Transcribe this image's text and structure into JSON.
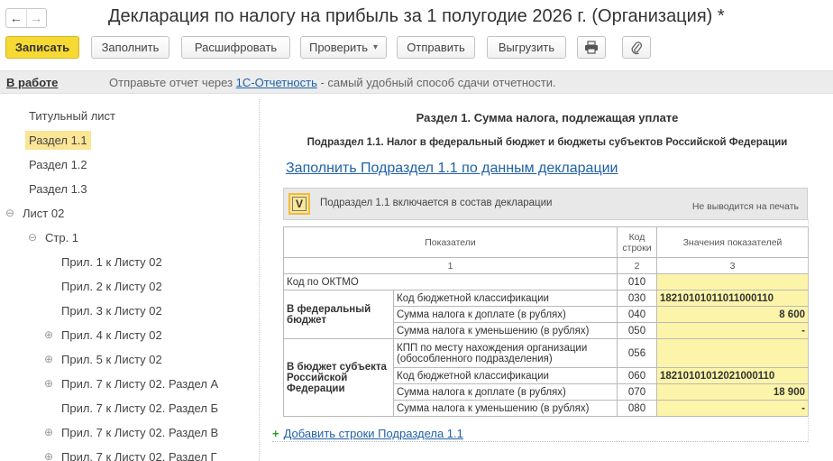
{
  "window": {
    "title": "Декларация по налогу на прибыль за 1 полугодие 2026 г. (Организация) *",
    "back_icon": "←",
    "forward_icon": "→"
  },
  "toolbar": {
    "save_label": "Записать",
    "fill_label": "Заполнить",
    "decode_label": "Расшифровать",
    "check_label": "Проверить",
    "check_dropdown": "▾",
    "send_label": "Отправить",
    "export_label": "Выгрузить",
    "print_icon": "printer-icon",
    "attach_icon": "paperclip-icon"
  },
  "infobar": {
    "status": "В работе",
    "message_before": "Отправьте отчет через ",
    "message_link": "1С-Отчетность",
    "message_after": " - самый удобный способ сдачи отчетности."
  },
  "tree": {
    "items": [
      {
        "label": "Титульный лист",
        "exp": ""
      },
      {
        "label": "Раздел 1.1",
        "exp": ""
      },
      {
        "label": "Раздел 1.2",
        "exp": ""
      },
      {
        "label": "Раздел 1.3",
        "exp": ""
      },
      {
        "label": "Лист 02",
        "exp": "⊖"
      },
      {
        "label": "Стр. 1",
        "exp": "⊖"
      },
      {
        "label": "Прил. 1 к Листу 02",
        "exp": ""
      },
      {
        "label": "Прил. 2 к Листу 02",
        "exp": ""
      },
      {
        "label": "Прил. 3 к Листу 02",
        "exp": ""
      },
      {
        "label": "Прил. 4 к Листу 02",
        "exp": "⊕"
      },
      {
        "label": "Прил. 5 к Листу 02",
        "exp": "⊕"
      },
      {
        "label": "Прил. 7 к Листу 02. Раздел А",
        "exp": "⊕"
      },
      {
        "label": "Прил. 7 к Листу 02. Раздел Б",
        "exp": ""
      },
      {
        "label": "Прил. 7 к Листу 02. Раздел В",
        "exp": "⊕"
      },
      {
        "label": "Прил. 7 к Листу 02. Раздел Г",
        "exp": "⊕"
      }
    ]
  },
  "content": {
    "section_title": "Раздел 1. Сумма налога, подлежащая уплате",
    "subsection_title": "Подраздел 1.1. Налог в федеральный бюджет и бюджеты субъектов Российской Федерации",
    "fill_link": "Заполнить Подраздел 1.1 по данным декларации",
    "include_flag": "V",
    "include_text": "Подраздел 1.1 включается в состав декларации",
    "no_print": "Не выводится на печать",
    "add_rows_icon": "+",
    "add_rows_link": "Добавить строки Подраздела 1.1"
  },
  "table": {
    "head_indicators": "Показатели",
    "head_code_1": "Код",
    "head_code_2": "строки",
    "head_values": "Значения показателей",
    "num_1": "1",
    "num_2": "2",
    "num_3": "3",
    "oktmo_label": "Код по ОКТМО",
    "oktmo_code": "010",
    "oktmo_value": "",
    "fed_group": "В федеральный бюджет",
    "fed_rows": [
      {
        "label": "Код бюджетной классификации",
        "code": "030",
        "value": "18210101011011000110"
      },
      {
        "label": "Сумма налога к доплате (в рублях)",
        "code": "040",
        "value": "8 600"
      },
      {
        "label": "Сумма налога к уменьшению (в рублях)",
        "code": "050",
        "value": "-"
      }
    ],
    "reg_group": "В бюджет субъекта Российской Федерации",
    "reg_rows": [
      {
        "label": "КПП по месту нахождения организации (обособленного подразделения)",
        "code": "056",
        "value": ""
      },
      {
        "label": "Код бюджетной классификации",
        "code": "060",
        "value": "18210101012021000110"
      },
      {
        "label": "Сумма налога к доплате (в рублях)",
        "code": "070",
        "value": "18 900"
      },
      {
        "label": "Сумма налога к уменьшению (в рублях)",
        "code": "080",
        "value": "-"
      }
    ]
  }
}
